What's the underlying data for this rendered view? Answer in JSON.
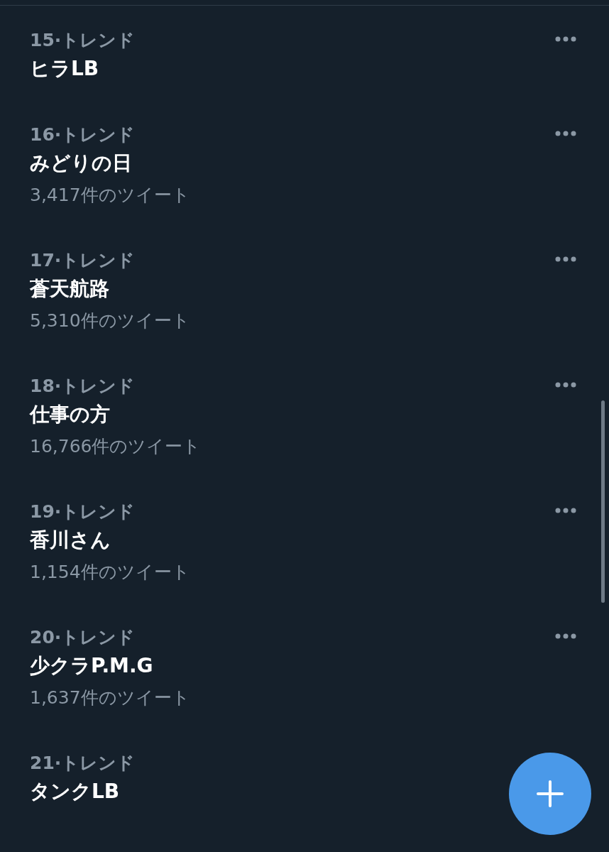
{
  "trends": [
    {
      "label": "15·トレンド",
      "title": "ヒラLB"
    },
    {
      "label": "16·トレンド",
      "title": "みどりの日",
      "count": "3,417件のツイート"
    },
    {
      "label": "17·トレンド",
      "title": "蒼天航路",
      "count": "5,310件のツイート"
    },
    {
      "label": "18·トレンド",
      "title": "仕事の方",
      "count": "16,766件のツイート"
    },
    {
      "label": "19·トレンド",
      "title": "香川さん",
      "count": "1,154件のツイート"
    },
    {
      "label": "20·トレンド",
      "title": "少クラP.M.G",
      "count": "1,637件のツイート"
    },
    {
      "label": "21·トレンド",
      "title": "タンクLB"
    }
  ]
}
